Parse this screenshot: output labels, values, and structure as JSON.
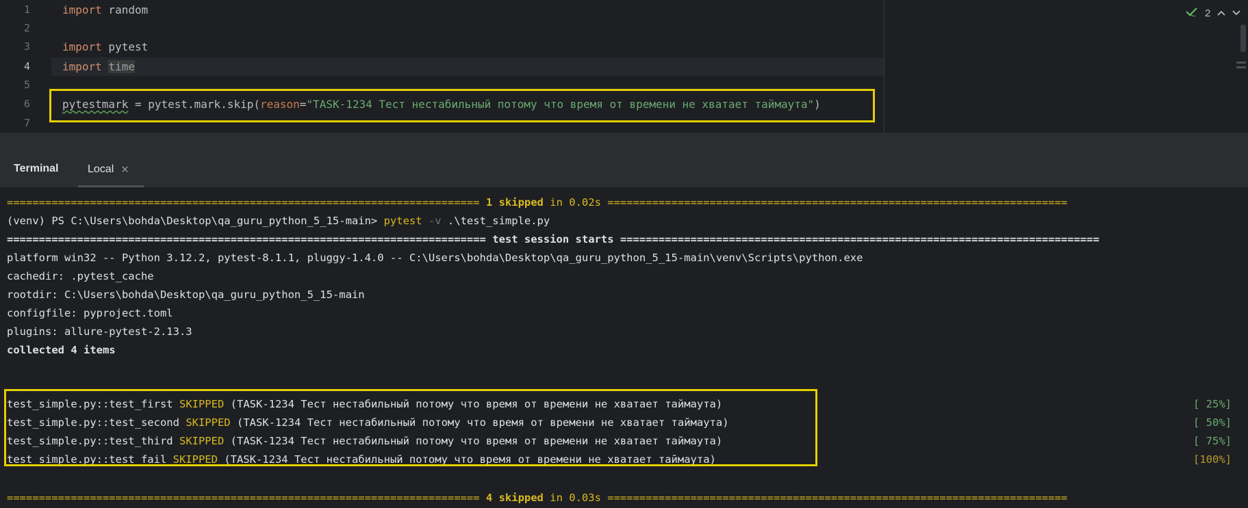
{
  "editor": {
    "line_numbers": [
      "1",
      "2",
      "3",
      "4",
      "5",
      "6",
      "7"
    ],
    "lines": {
      "l1_kw": "import",
      "l1_rest": " random",
      "l3_kw": "import",
      "l3_rest": " pytest",
      "l4_kw": "import",
      "l4_sp": " ",
      "l4_rest": "time",
      "l6_var": "pytestmark",
      "l6_mid": " = pytest.mark.skip(",
      "l6_param": "reason",
      "l6_eq": "=",
      "l6_str": "\"TASK-1234 Тест нестабильный потому что время от времени не хватает таймаута\"",
      "l6_end": ")"
    },
    "inspection_count": "2",
    "icons": {
      "check": "check-icon",
      "up": "arrow-up-icon",
      "down": "arrow-down-icon"
    }
  },
  "terminal": {
    "title": "Terminal",
    "tab_label": "Local",
    "rule_short": "==========================================================================",
    "rule_left": "==========================================================================",
    "rule_right": "========================================================================",
    "rule_left2": "===========================================================================",
    "rule_right2": "===========================================================================",
    "summary1_count": "1 skipped",
    "summary1_time": "in 0.02s",
    "prompt": "(venv) PS C:\\Users\\bohda\\Desktop\\qa_guru_python_5_15-main> ",
    "cmd": "pytest",
    "cmd_flag": " -v",
    "cmd_arg": " .\\test_simple.py",
    "session_start": "test session starts",
    "platform": "platform win32 -- Python 3.12.2, pytest-8.1.1, pluggy-1.4.0 -- C:\\Users\\bohda\\Desktop\\qa_guru_python_5_15-main\\venv\\Scripts\\python.exe",
    "cachedir": "cachedir: .pytest_cache",
    "rootdir": "rootdir: C:\\Users\\bohda\\Desktop\\qa_guru_python_5_15-main",
    "configfile": "configfile: pyproject.toml",
    "plugins": "plugins: allure-pytest-2.13.3",
    "collected": "collected 4 items",
    "tests": [
      {
        "name": "test_simple.py::test_first",
        "status": "SKIPPED",
        "reason": "(TASK-1234 Тест нестабильный потому что время от времени не хватает таймаута)",
        "progress": "[ 25%]"
      },
      {
        "name": "test_simple.py::test_second",
        "status": "SKIPPED",
        "reason": "(TASK-1234 Тест нестабильный потому что время от времени не хватает таймаута)",
        "progress": "[ 50%]"
      },
      {
        "name": "test_simple.py::test_third",
        "status": "SKIPPED",
        "reason": "(TASK-1234 Тест нестабильный потому что время от времени не хватает таймаута)",
        "progress": "[ 75%]"
      },
      {
        "name": "test_simple.py::test_fail",
        "status": "SKIPPED",
        "reason": "(TASK-1234 Тест нестабильный потому что время от времени не хватает таймаута)",
        "progress": "[100%]"
      }
    ],
    "summary2_count": "4 skipped",
    "summary2_time": "in 0.03s"
  },
  "colors": {
    "highlight_box": "#e3d000",
    "skipped": "#d7ba20",
    "progress_green": "#6aab73",
    "progress_final": "#b79a2e"
  }
}
